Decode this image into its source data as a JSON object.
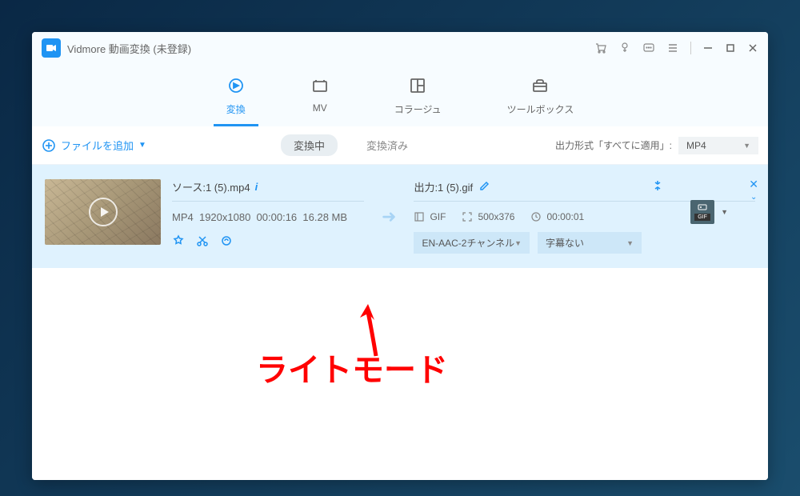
{
  "app": {
    "title": "Vidmore 動画変換 (未登録)"
  },
  "tabs": {
    "items": [
      {
        "label": "変換",
        "icon": "convert"
      },
      {
        "label": "MV",
        "icon": "mv"
      },
      {
        "label": "コラージュ",
        "icon": "collage"
      },
      {
        "label": "ツールボックス",
        "icon": "toolbox"
      }
    ]
  },
  "toolbar": {
    "add_file_label": "ファイルを追加",
    "status_tabs": [
      "変換中",
      "変換済み"
    ],
    "output_format_label": "出力形式「すべてに適用」:",
    "output_format_value": "MP4"
  },
  "file": {
    "source": {
      "label": "ソース:1 (5).mp4",
      "format": "MP4",
      "resolution": "1920x1080",
      "duration": "00:00:16",
      "size": "16.28 MB"
    },
    "output": {
      "label": "出力:1 (5).gif",
      "format": "GIF",
      "resolution": "500x376",
      "duration": "00:00:01",
      "audio": "EN-AAC-2チャンネル",
      "subtitle": "字幕ない",
      "target_format": "GIF"
    }
  },
  "annotation": {
    "text": "ライトモード"
  },
  "colors": {
    "accent": "#2094f3",
    "highlight_bg": "#dff2fe",
    "annotation": "#ff0000"
  }
}
